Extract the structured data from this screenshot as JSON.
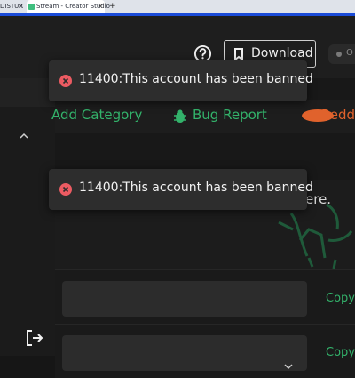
{
  "browser": {
    "tabs": [
      {
        "label": "DISTUR",
        "close": "×"
      },
      {
        "label": "Stream - Creator Studio",
        "close": "×"
      }
    ],
    "new_tab": "+"
  },
  "header": {
    "download_label": "Download",
    "status_label": "O"
  },
  "categories": [
    {
      "label": "Add Category"
    },
    {
      "label": "Bug Report"
    },
    {
      "label": "Redd"
    }
  ],
  "panel": {
    "text": "ere."
  },
  "rows": [
    {
      "copy_label": "Copy"
    },
    {
      "copy_label": "Copy"
    }
  ],
  "toasts": [
    {
      "message": "11400:This account has been banned"
    },
    {
      "message": "11400:This account has been banned"
    }
  ],
  "colors": {
    "accent": "#33b36b",
    "error": "#ec5b62",
    "reddit": "#e0622c"
  }
}
